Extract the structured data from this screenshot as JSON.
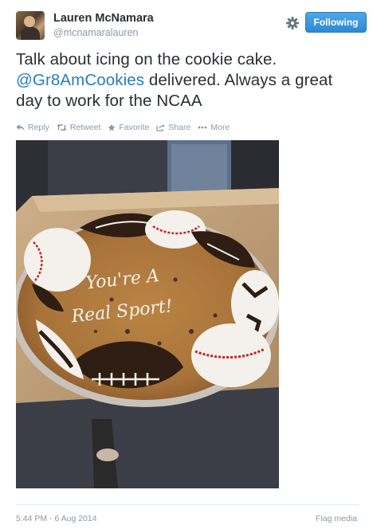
{
  "user": {
    "display_name": "Lauren McNamara",
    "handle": "@mcnamaralauren"
  },
  "follow_button": {
    "label": "Following"
  },
  "tweet": {
    "text_before": "Talk about icing on the cookie cake. ",
    "mention": "@Gr8AmCookies",
    "text_after": " delivered. Always a great day to work for the NCAA"
  },
  "actions": [
    {
      "label": "Reply",
      "icon": "reply-icon"
    },
    {
      "label": "Retweet",
      "icon": "retweet-icon"
    },
    {
      "label": "Favorite",
      "icon": "star-icon"
    },
    {
      "label": "Share",
      "icon": "share-icon"
    },
    {
      "label": "More",
      "icon": "more-icon"
    }
  ],
  "photo": {
    "cake_text_line1": "You're A",
    "cake_text_line2": "Real Sport!"
  },
  "footer": {
    "timestamp": "5:44 PM - 6 Aug 2014",
    "flag_label": "Flag media"
  },
  "colors": {
    "link": "#2b7bb9",
    "follow_button": "#2b8ad6",
    "muted": "#8899a6"
  }
}
